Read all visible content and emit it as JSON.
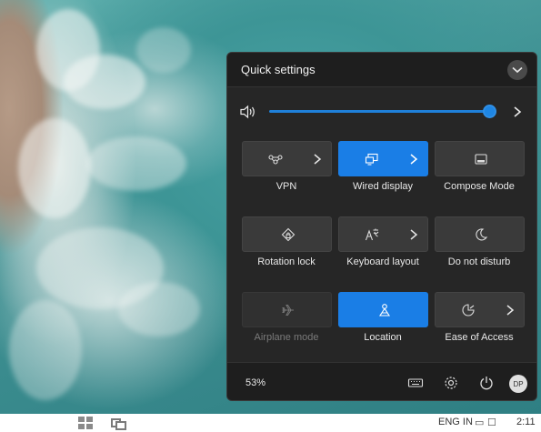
{
  "quick_settings": {
    "title": "Quick settings",
    "volume": {
      "level": 1.0
    },
    "tiles": [
      {
        "label": "VPN",
        "state": "off",
        "icon": "vpn-icon",
        "has_arrow": true
      },
      {
        "label": "Wired display",
        "state": "on",
        "icon": "display-icon",
        "has_arrow": true
      },
      {
        "label": "Compose Mode",
        "state": "off",
        "icon": "compose-icon",
        "has_arrow": false
      },
      {
        "label": "Rotation lock",
        "state": "off",
        "icon": "rotation-lock-icon",
        "has_arrow": false
      },
      {
        "label": "Keyboard layout",
        "state": "off",
        "icon": "keyboard-layout-icon",
        "has_arrow": true
      },
      {
        "label": "Do not disturb",
        "state": "off",
        "icon": "moon-icon",
        "has_arrow": false
      },
      {
        "label": "Airplane mode",
        "state": "disabled",
        "icon": "airplane-icon",
        "has_arrow": false
      },
      {
        "label": "Location",
        "state": "on",
        "icon": "location-icon",
        "has_arrow": false
      },
      {
        "label": "Ease of Access",
        "state": "off",
        "icon": "accessibility-icon",
        "has_arrow": true
      }
    ],
    "footer": {
      "battery": "53%",
      "avatar_initials": "DP"
    }
  },
  "colors": {
    "accent": "#1a7ee6",
    "panel": "#262626",
    "tile": "#3a3a3a"
  },
  "taskbar": {
    "language": "ENG IN",
    "time": "2:11"
  }
}
